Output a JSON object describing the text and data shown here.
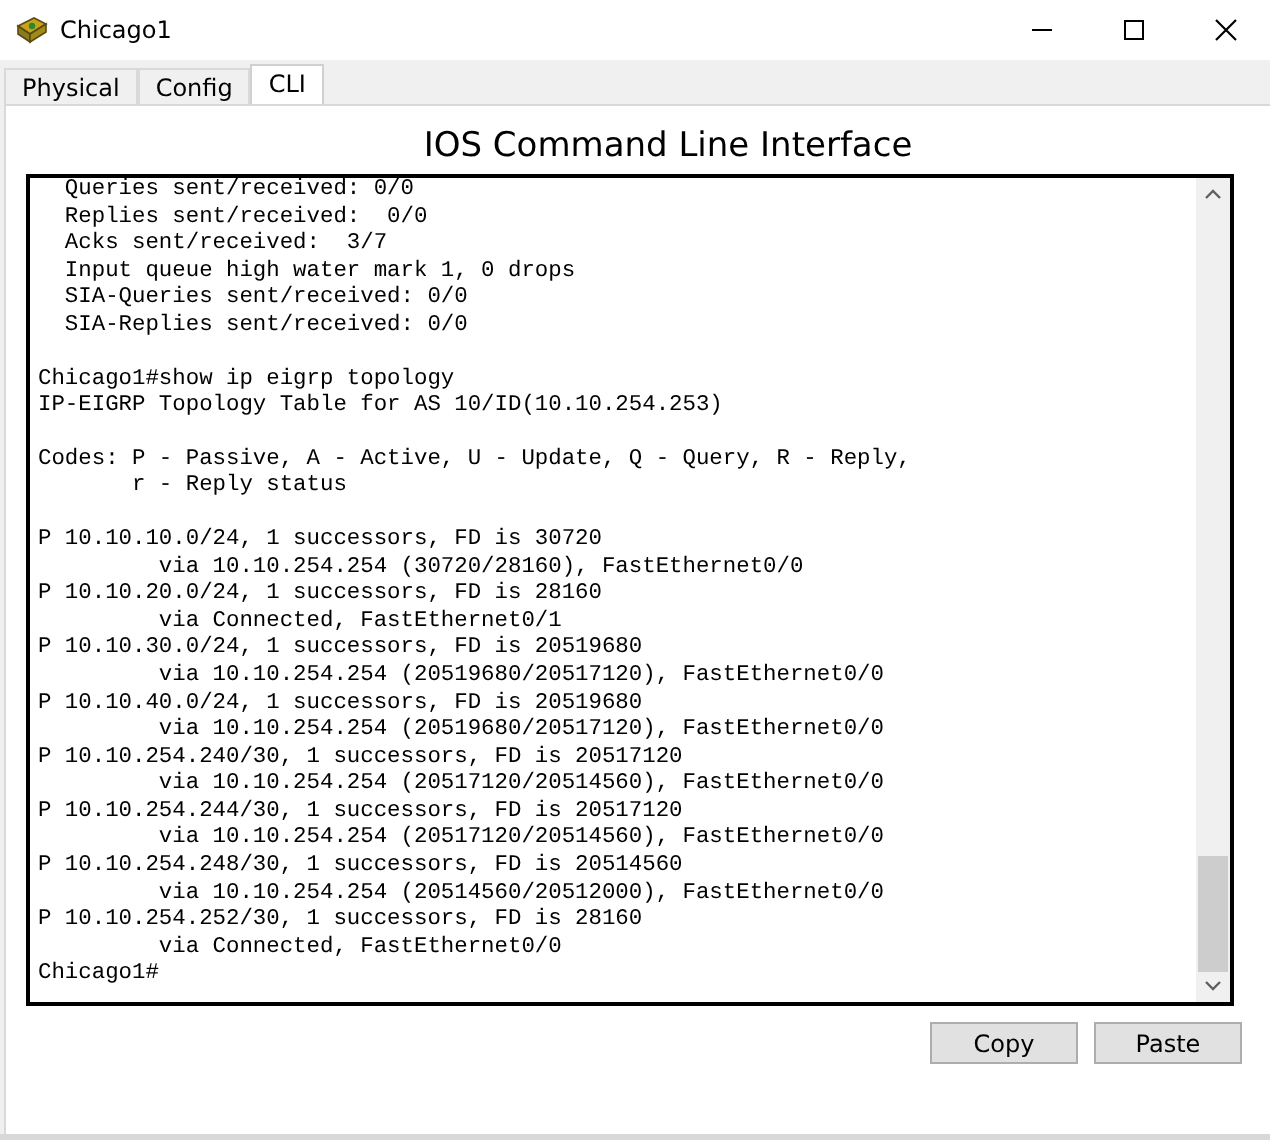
{
  "window": {
    "title": "Chicago1"
  },
  "tabs": [
    {
      "label": "Physical",
      "selected": false
    },
    {
      "label": "Config",
      "selected": false
    },
    {
      "label": "CLI",
      "selected": true
    }
  ],
  "heading": "IOS Command Line Interface",
  "terminal": {
    "blocks": [
      [
        "  Queries sent/received: 0/0",
        "  Replies sent/received:  0/0",
        "  Acks sent/received:  3/7",
        "  Input queue high water mark 1, 0 drops",
        "  SIA-Queries sent/received: 0/0",
        "  SIA-Replies sent/received: 0/0"
      ],
      [
        "Chicago1#show ip eigrp topology",
        "IP-EIGRP Topology Table for AS 10/ID(10.10.254.253)"
      ],
      [
        "Codes: P - Passive, A - Active, U - Update, Q - Query, R - Reply,",
        "       r - Reply status"
      ],
      [
        "P 10.10.10.0/24, 1 successors, FD is 30720",
        "         via 10.10.254.254 (30720/28160), FastEthernet0/0",
        "P 10.10.20.0/24, 1 successors, FD is 28160",
        "         via Connected, FastEthernet0/1",
        "P 10.10.30.0/24, 1 successors, FD is 20519680",
        "         via 10.10.254.254 (20519680/20517120), FastEthernet0/0",
        "P 10.10.40.0/24, 1 successors, FD is 20519680",
        "         via 10.10.254.254 (20519680/20517120), FastEthernet0/0",
        "P 10.10.254.240/30, 1 successors, FD is 20517120",
        "         via 10.10.254.254 (20517120/20514560), FastEthernet0/0",
        "P 10.10.254.244/30, 1 successors, FD is 20517120",
        "         via 10.10.254.254 (20517120/20514560), FastEthernet0/0",
        "P 10.10.254.248/30, 1 successors, FD is 20514560",
        "         via 10.10.254.254 (20514560/20512000), FastEthernet0/0",
        "P 10.10.254.252/30, 1 successors, FD is 28160",
        "         via Connected, FastEthernet0/0",
        "Chicago1#"
      ]
    ]
  },
  "buttons": [
    "Copy",
    "Paste"
  ]
}
